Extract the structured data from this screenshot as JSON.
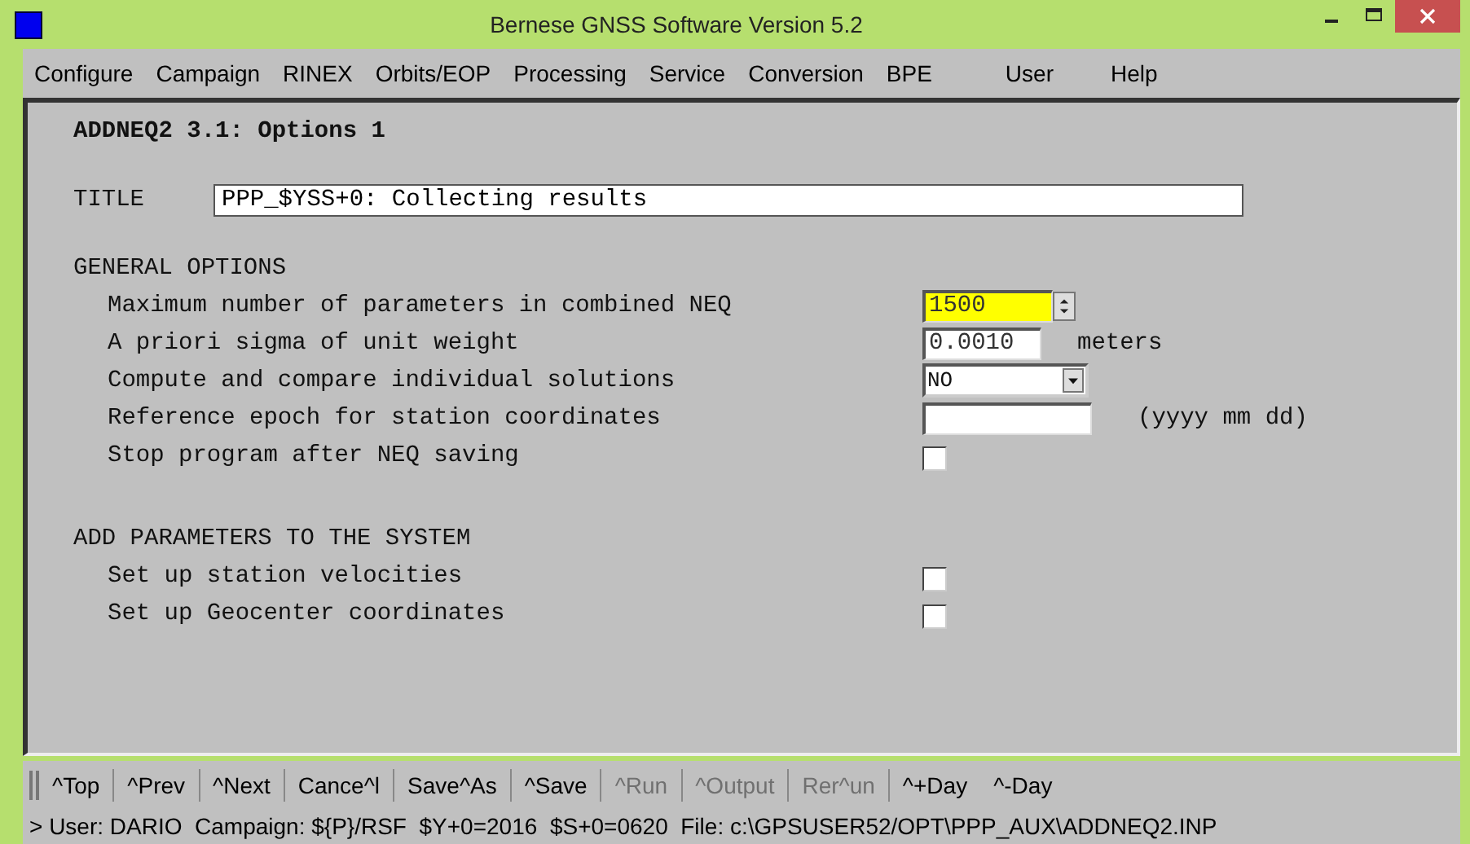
{
  "window": {
    "title": "Bernese GNSS Software Version 5.2"
  },
  "menu": [
    "Configure",
    "Campaign",
    "RINEX",
    "Orbits/EOP",
    "Processing",
    "Service",
    "Conversion",
    "BPE",
    "User",
    "Help"
  ],
  "panel": {
    "heading": "ADDNEQ2 3.1: Options 1",
    "title_field": {
      "label": "TITLE",
      "value": "PPP_$YSS+0: Collecting results"
    },
    "sections": [
      {
        "heading": "GENERAL OPTIONS",
        "fields": [
          {
            "kind": "spin",
            "label": "Maximum number of parameters in combined NEQ",
            "value": "1500",
            "focused": true
          },
          {
            "kind": "text",
            "label": "A priori sigma of unit weight",
            "value": "0.0010",
            "unit": "meters",
            "focused": false
          },
          {
            "kind": "dropdown",
            "label": "Compute and compare individual solutions",
            "value": "NO"
          },
          {
            "kind": "date",
            "label": "Reference epoch for station coordinates",
            "unit": "(yyyy mm dd)",
            "focused": false
          },
          {
            "kind": "checkbox",
            "label": "Stop program after NEQ saving",
            "checked": false
          }
        ]
      },
      {
        "heading": "ADD PARAMETERS TO THE SYSTEM",
        "fields": [
          {
            "kind": "checkbox",
            "label": "Set up station velocities",
            "checked": false
          },
          {
            "kind": "checkbox",
            "label": "Set up Geocenter coordinates",
            "checked": false
          }
        ]
      }
    ]
  },
  "toolbar": [
    {
      "label": "^Top",
      "disabled": false
    },
    {
      "label": "^Prev",
      "disabled": false
    },
    {
      "label": "^Next",
      "disabled": false
    },
    {
      "label": "Cance^l",
      "disabled": false
    },
    {
      "label": "Save^As",
      "disabled": false
    },
    {
      "label": "^Save",
      "disabled": false
    },
    {
      "label": "^Run",
      "disabled": true
    },
    {
      "label": "^Output",
      "disabled": true
    },
    {
      "label": "Rer^un",
      "disabled": true
    },
    {
      "label": "^+Day",
      "disabled": false
    },
    {
      "label": "^-Day",
      "disabled": false
    }
  ],
  "status_bar": "> User: DARIO  Campaign: ${P}/RSF  $Y+0=2016  $S+0=0620  File: c:\\GPSUSER52/OPT\\PPP_AUX\\ADDNEQ2.INP"
}
